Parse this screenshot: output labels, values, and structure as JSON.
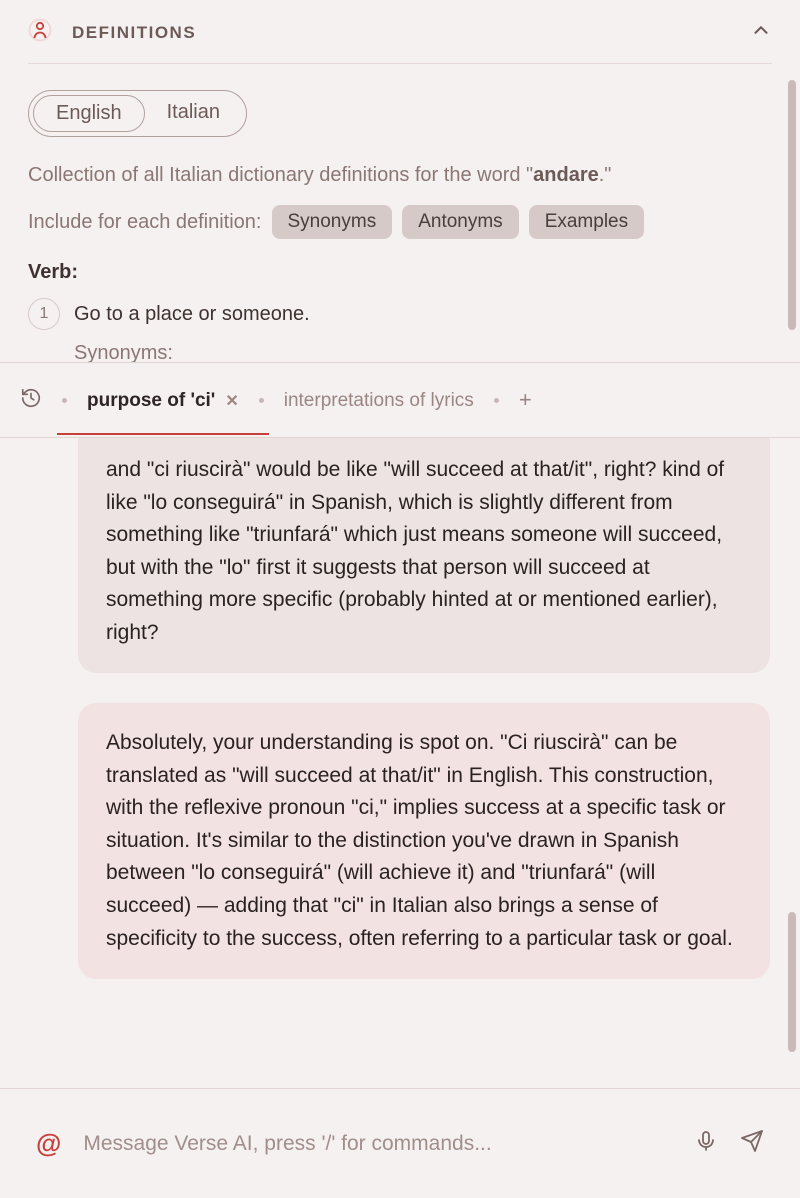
{
  "definitions": {
    "title": "DEFINITIONS",
    "languages": [
      "English",
      "Italian"
    ],
    "active_language": "English",
    "collection_prefix": "Collection of all Italian dictionary definitions for the word \"",
    "word": "andare",
    "collection_suffix": ".\"",
    "include_label": "Include for each definition:",
    "chips": [
      "Synonyms",
      "Antonyms",
      "Examples"
    ],
    "pos": "Verb",
    "pos_suffix": ":",
    "entries": [
      {
        "n": "1",
        "text": "Go to a place or someone."
      }
    ],
    "synonyms_label": "Synonyms:"
  },
  "tabs": {
    "items": [
      {
        "label": "purpose of 'ci'",
        "active": true
      },
      {
        "label": "interpretations of lyrics",
        "active": false
      }
    ]
  },
  "chat": {
    "user": "and \"ci riuscirà\" would be like \"will succeed at that/it\", right? kind of like \"lo conseguirá\" in Spanish, which is slightly different from something like \"triunfará\" which just means someone will succeed, but with the \"lo\" first it suggests that person will succeed at something more specific (probably hinted at or mentioned earlier), right?",
    "assistant": "Absolutely, your understanding is spot on. \"Ci riuscirà\" can be translated as \"will succeed at that/it\" in English. This construction, with the reflexive pronoun \"ci,\" implies success at a specific task or situation. It's similar to the distinction you've drawn in Spanish between \"lo conseguirá\" (will achieve it) and \"triunfará\" (will succeed) — adding that \"ci\" in Italian also brings a sense of specificity to the success, often referring to a particular task or goal."
  },
  "input": {
    "placeholder": "Message Verse AI, press '/' for commands..."
  }
}
